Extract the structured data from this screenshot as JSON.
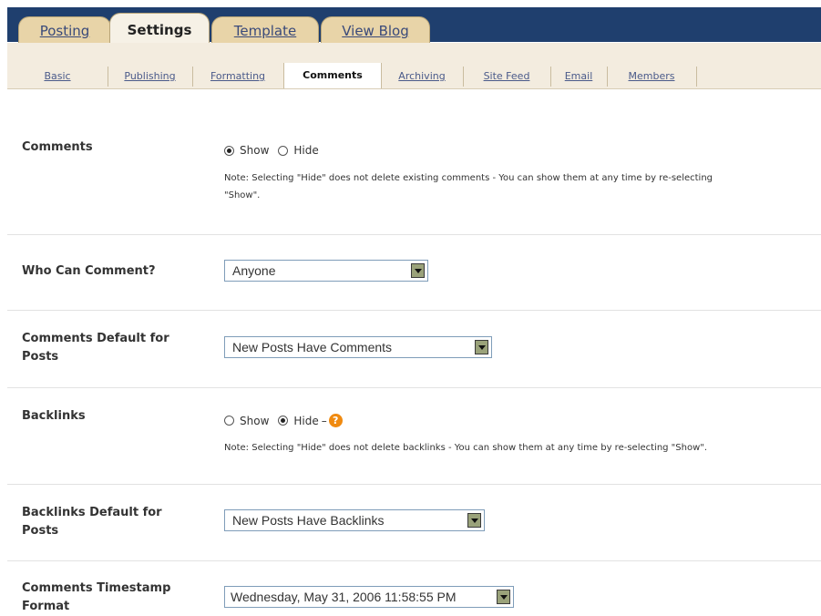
{
  "main_tabs": [
    {
      "label": "Posting",
      "active": false
    },
    {
      "label": "Settings",
      "active": true
    },
    {
      "label": "Template",
      "active": false
    },
    {
      "label": "View Blog",
      "active": false
    }
  ],
  "sub_tabs": [
    {
      "label": "Basic",
      "active": false
    },
    {
      "label": "Publishing",
      "active": false
    },
    {
      "label": "Formatting",
      "active": false
    },
    {
      "label": "Comments",
      "active": true
    },
    {
      "label": "Archiving",
      "active": false
    },
    {
      "label": "Site Feed",
      "active": false
    },
    {
      "label": "Email",
      "active": false
    },
    {
      "label": "Members",
      "active": false
    }
  ],
  "settings": {
    "comments": {
      "label": "Comments",
      "options": [
        {
          "label": "Show",
          "checked": true
        },
        {
          "label": "Hide",
          "checked": false
        }
      ],
      "note_line1": "Note: Selecting \"Hide\" does not delete existing comments - You can show them at any time by re-selecting",
      "note_line2": "\"Show\"."
    },
    "who_can_comment": {
      "label": "Who Can Comment?",
      "value": "Anyone"
    },
    "comments_default": {
      "label_line1": "Comments Default for",
      "label_line2": "Posts",
      "value": "New Posts Have Comments"
    },
    "backlinks": {
      "label": "Backlinks",
      "options": [
        {
          "label": "Show",
          "checked": false
        },
        {
          "label": "Hide",
          "checked": true
        }
      ],
      "help_dash": "–",
      "help_icon": "?",
      "note": "Note: Selecting \"Hide\" does not delete backlinks - You can show them at any time by re-selecting \"Show\"."
    },
    "backlinks_default": {
      "label_line1": "Backlinks Default for",
      "label_line2": "Posts",
      "value": "New Posts Have Backlinks"
    },
    "timestamp_format": {
      "label_line1": "Comments Timestamp",
      "label_line2": "Format",
      "value": "Wednesday, May 31, 2006 11:58:55 PM"
    }
  }
}
